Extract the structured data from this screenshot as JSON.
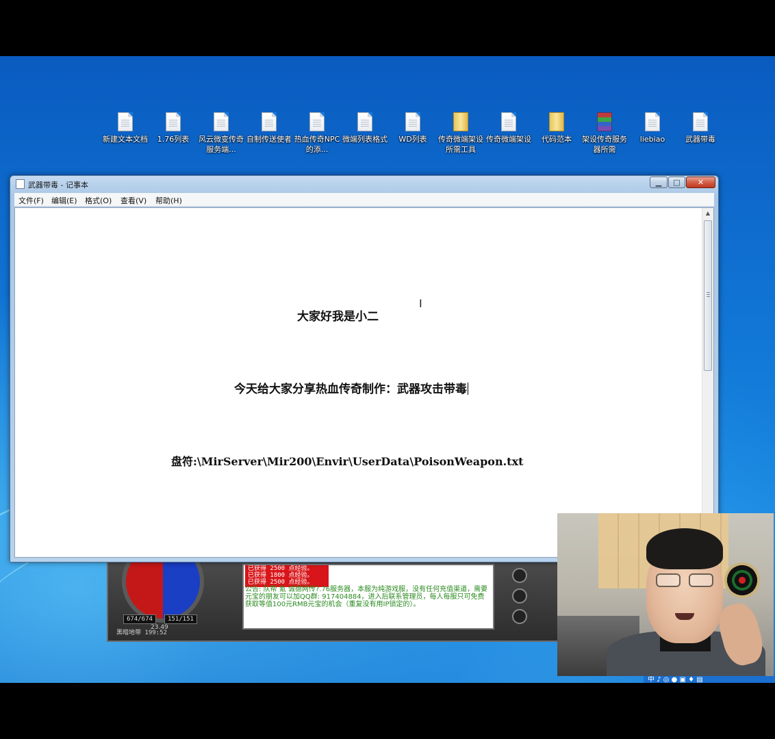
{
  "desktop": {
    "icons": [
      {
        "label": "新建文本文档",
        "icon": "text-file-icon"
      },
      {
        "label": "1.76列表",
        "icon": "text-file-icon"
      },
      {
        "label": "风云微变传奇服务端...",
        "icon": "text-file-icon"
      },
      {
        "label": "自制传送使者",
        "icon": "text-file-icon"
      },
      {
        "label": "热血传奇NPC的添...",
        "icon": "text-file-icon"
      },
      {
        "label": "微端列表格式",
        "icon": "text-file-icon"
      },
      {
        "label": "WD列表",
        "icon": "text-file-icon"
      },
      {
        "label": "传奇微端架设所需工具",
        "icon": "folder-icon"
      },
      {
        "label": "传奇微端架设",
        "icon": "text-file-icon"
      },
      {
        "label": "代码范本",
        "icon": "folder-icon"
      },
      {
        "label": "架设传奇服务器所需",
        "icon": "archive-icon"
      },
      {
        "label": "liebiao",
        "icon": "text-file-icon"
      },
      {
        "label": "武器带毒",
        "icon": "text-file-icon"
      }
    ]
  },
  "notepad": {
    "title": "武器带毒 - 记事本",
    "buttons": {
      "minimize": "▁",
      "maximize": "□",
      "close": "✕"
    },
    "menu": [
      "文件(F)",
      "编辑(E)",
      "格式(O)",
      "查看(V)",
      "帮助(H)"
    ],
    "lines": [
      "大家好我是小二",
      "今天给大家分享热血传奇制作：武器攻击带毒",
      "盘符:\\MirServer\\Mir200\\Envir\\UserData\\PoisonWeapon.txt"
    ]
  },
  "game_window": {
    "hp": "674/674",
    "mp": "151/151",
    "zone": "黑暗地带 199:52",
    "red_lines": [
      "已获得 2500 点经验。",
      "已获得 1800 点经验。",
      "已获得 2500 点经验。"
    ],
    "notice": "公告: 队帮 氪 诚德网传?.76服务器，本服为纯游戏服，没有任何充值渠道，需要元宝的朋友可以加QQ群: 917404884，进入后联系管理员，每人每服只可免费获取等值100元RMB元宝的机会（重复没有用IP锁定的）。",
    "speed": "23.49"
  },
  "taskbar": {
    "tray": "中 ♪ ◎ ● ▣ ♦ ▤"
  }
}
